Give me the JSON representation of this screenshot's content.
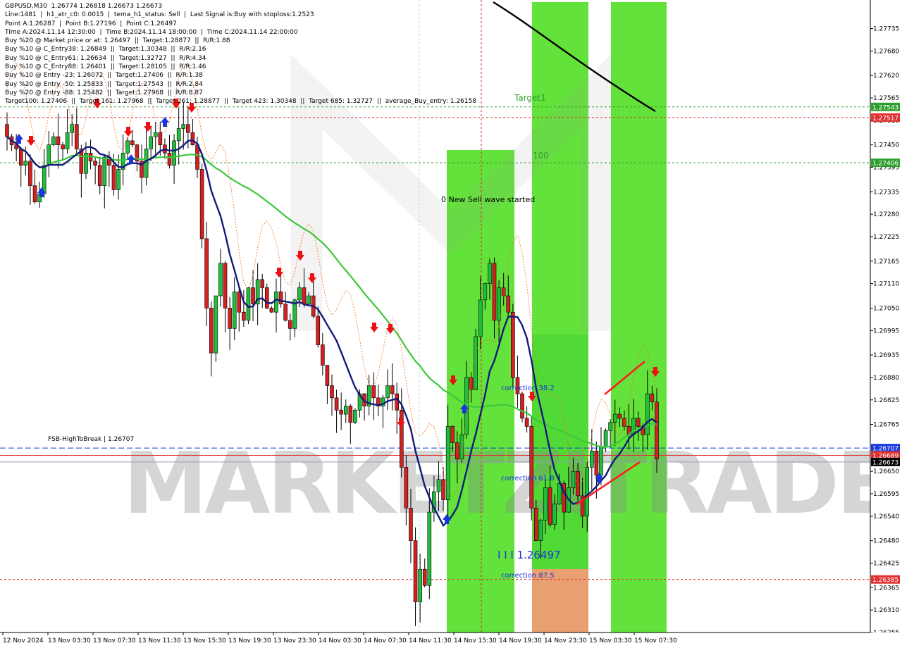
{
  "header_lines": [
    "GBPUSD,M30  1.26774 1.26818 1.26673 1.26673",
    "Line:1481  |  h1_atr_c0: 0.0015  |  tema_h1_status: Sell  |  Last Signal is:Buy with stoploss:1.2523",
    "Point A:1.26287  |  Point B:1.27196  |  Point C:1.26497",
    "Time A:2024.11.14 12:30:00  |  Time B:2024.11.14 18:00:00  |  Time C:2024.11.14 22:00:00",
    "Buy %20 @ Market price or at: 1.26497  ||  Target:1.28877  ||  R/R:1.88",
    "Buy %10 @ C_Entry38: 1.26849  ||  Target:1.30348  ||  R/R:2.16",
    "Buy %10 @ C_Entry61: 1.26634  ||  Target:1.32727  ||  R/R:4.34",
    "Buy %10 @ C_Entry88: 1.26401  ||  Target:1.28105  ||  R/R:1.46",
    "Buy %10 @ Entry -23: 1.26072  ||  Target:1.27406  ||  R/R:1.38",
    "Buy %20 @ Entry -50: 1.25833  ||  Target:1.27543  ||  R/R:2.84",
    "Buy %20 @ Entry -88: 1.25482  ||  Target:1.27968  ||  R/R:8.87",
    "Target100: 1.27406  ||  Target 161: 1.27968  ||  Target 261: 1.28877  ||  Target 423: 1.30348  ||  Target 685: 1.32727  ||  average_Buy_entry: 1.26158"
  ],
  "chart_data": {
    "type": "candlestick",
    "symbol": "GBPUSD",
    "timeframe": "M30",
    "ylim": [
      1.26255,
      1.27805
    ],
    "y_ticks": [
      "1.27735",
      "1.27680",
      "1.27620",
      "1.27565",
      "1.27510",
      "1.27450",
      "1.27395",
      "1.27335",
      "1.27280",
      "1.27225",
      "1.27165",
      "1.27110",
      "1.27050",
      "1.26995",
      "1.26935",
      "1.26880",
      "1.26825",
      "1.26765",
      "1.26710",
      "1.26650",
      "1.26595",
      "1.26540",
      "1.26480",
      "1.26425",
      "1.26365",
      "1.26310",
      "1.26255"
    ],
    "x_ticks": [
      "12 Nov 2024",
      "13 Nov 03:30",
      "13 Nov 07:30",
      "13 Nov 11:30",
      "13 Nov 15:30",
      "13 Nov 19:30",
      "13 Nov 23:30",
      "14 Nov 03:30",
      "14 Nov 07:30",
      "14 Nov 11:30",
      "14 Nov 15:30",
      "14 Nov 19:30",
      "14 Nov 23:30",
      "15 Nov 03:30",
      "15 Nov 07:30"
    ],
    "price_labels": [
      {
        "value": "1.27543",
        "color": "#2e9e2e"
      },
      {
        "value": "1.27517",
        "color": "#e03030"
      },
      {
        "value": "1.27406",
        "color": "#2e9e2e"
      },
      {
        "value": "1.26707",
        "color": "#1a3adf"
      },
      {
        "value": "1.26689",
        "color": "#e03030"
      },
      {
        "value": "1.26673",
        "color": "#000000"
      },
      {
        "value": "1.26385",
        "color": "#e03030"
      }
    ],
    "annotations": {
      "target1": "Target1",
      "t100": "100",
      "new_sell": "0 New Sell wave started",
      "c382": "correction 38.2",
      "c618": "correction 61.8",
      "c875": "correction 87.5",
      "point_c": "I I I 1.26497",
      "fsb": "FSB-HighToBreak  |  1.26707"
    },
    "watermark": "MARKETZITRADE",
    "closes": [
      1.2747,
      1.2745,
      1.2744,
      1.274,
      1.2741,
      1.2735,
      1.2731,
      1.2733,
      1.274,
      1.2745,
      1.2747,
      1.2745,
      1.2744,
      1.2748,
      1.275,
      1.2744,
      1.2738,
      1.2743,
      1.2741,
      1.274,
      1.2735,
      1.2742,
      1.274,
      1.2734,
      1.2739,
      1.2743,
      1.2746,
      1.2745,
      1.2741,
      1.2737,
      1.2744,
      1.2747,
      1.2748,
      1.2745,
      1.2743,
      1.274,
      1.2746,
      1.2749,
      1.275,
      1.2748,
      1.2745,
      1.2739,
      1.2722,
      1.2705,
      1.2694,
      1.2708,
      1.2716,
      1.2705,
      1.27,
      1.2709,
      1.2704,
      1.2702,
      1.271,
      1.2706,
      1.2712,
      1.271,
      1.2705,
      1.2704,
      1.2709,
      1.2706,
      1.2702,
      1.27,
      1.2707,
      1.271,
      1.2706,
      1.2708,
      1.2703,
      1.2696,
      1.2691,
      1.2686,
      1.2683,
      1.268,
      1.2679,
      1.2681,
      1.2677,
      1.268,
      1.2684,
      1.2681,
      1.2686,
      1.2683,
      1.2681,
      1.2683,
      1.2686,
      1.2684,
      1.268,
      1.2666,
      1.2656,
      1.2648,
      1.2633,
      1.2641,
      1.2637,
      1.2655,
      1.266,
      1.2663,
      1.2658,
      1.2676,
      1.2672,
      1.2668,
      1.2674,
      1.2688,
      1.2685,
      1.2698,
      1.2707,
      1.2711,
      1.2716,
      1.2702,
      1.271,
      1.2708,
      1.2704,
      1.2688,
      1.2684,
      1.2678,
      1.2676,
      1.2656,
      1.2648,
      1.2653,
      1.2661,
      1.2652,
      1.2657,
      1.2662,
      1.2655,
      1.2661,
      1.2665,
      1.2659,
      1.2654,
      1.2666,
      1.267,
      1.2664,
      1.2671,
      1.2675,
      1.2677,
      1.2679,
      1.2678,
      1.2676,
      1.2674,
      1.2678,
      1.2676,
      1.2674,
      1.2684,
      1.2682,
      1.2668
    ]
  }
}
